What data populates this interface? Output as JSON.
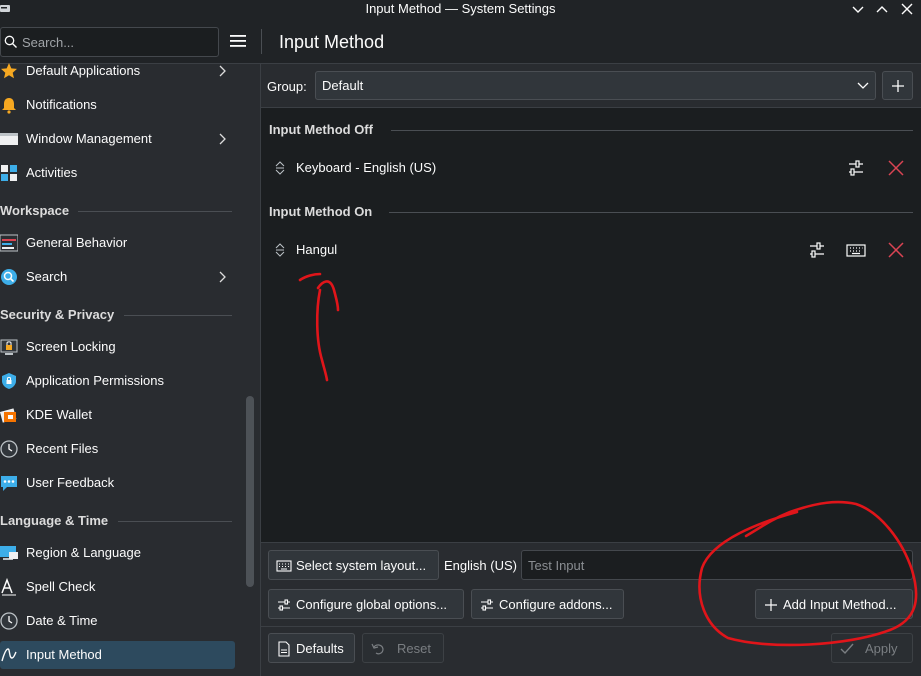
{
  "window": {
    "title": "Input Method — System Settings"
  },
  "header": {
    "search_placeholder": "Search...",
    "page_title": "Input Method"
  },
  "sidebar": {
    "items": [
      {
        "label": "Default Applications",
        "icon": "star-icon",
        "has_children": true
      },
      {
        "label": "Notifications",
        "icon": "bell-icon",
        "has_children": false
      },
      {
        "label": "Window Management",
        "icon": "window-icon",
        "has_children": true
      },
      {
        "label": "Activities",
        "icon": "activities-icon",
        "has_children": false
      },
      {
        "label": "General Behavior",
        "icon": "general-behavior-icon",
        "has_children": false
      },
      {
        "label": "Search",
        "icon": "search-icon",
        "has_children": true
      },
      {
        "label": "Screen Locking",
        "icon": "screen-lock-icon",
        "has_children": false
      },
      {
        "label": "Application Permissions",
        "icon": "shield-icon",
        "has_children": false
      },
      {
        "label": "KDE Wallet",
        "icon": "wallet-icon",
        "has_children": false
      },
      {
        "label": "Recent Files",
        "icon": "clock-icon",
        "has_children": false
      },
      {
        "label": "User Feedback",
        "icon": "feedback-icon",
        "has_children": false
      },
      {
        "label": "Region & Language",
        "icon": "region-icon",
        "has_children": false
      },
      {
        "label": "Spell Check",
        "icon": "spell-check-icon",
        "has_children": false
      },
      {
        "label": "Date & Time",
        "icon": "clock-icon",
        "has_children": false
      },
      {
        "label": "Input Method",
        "icon": "input-method-icon",
        "has_children": false,
        "active": true
      }
    ],
    "sections": {
      "workspace": "Workspace",
      "security": "Security & Privacy",
      "language": "Language & Time"
    }
  },
  "main": {
    "group_label": "Group:",
    "group_value": "Default",
    "off_header": "Input Method Off",
    "on_header": "Input Method On",
    "off_items": [
      {
        "label": "Keyboard - English (US)"
      }
    ],
    "on_items": [
      {
        "label": "Hangul"
      }
    ]
  },
  "bottom": {
    "select_layout_label": "Select system layout...",
    "layout_name": "English (US)",
    "test_input_placeholder": "Test Input",
    "configure_global_label": "Configure global options...",
    "configure_addons_label": "Configure addons...",
    "add_input_method_label": "Add Input Method..."
  },
  "footer": {
    "defaults_label": "Defaults",
    "reset_label": "Reset",
    "apply_label": "Apply"
  },
  "colors": {
    "accent": "#3daee9",
    "remove": "#da4453",
    "annotation": "#e0151a"
  }
}
